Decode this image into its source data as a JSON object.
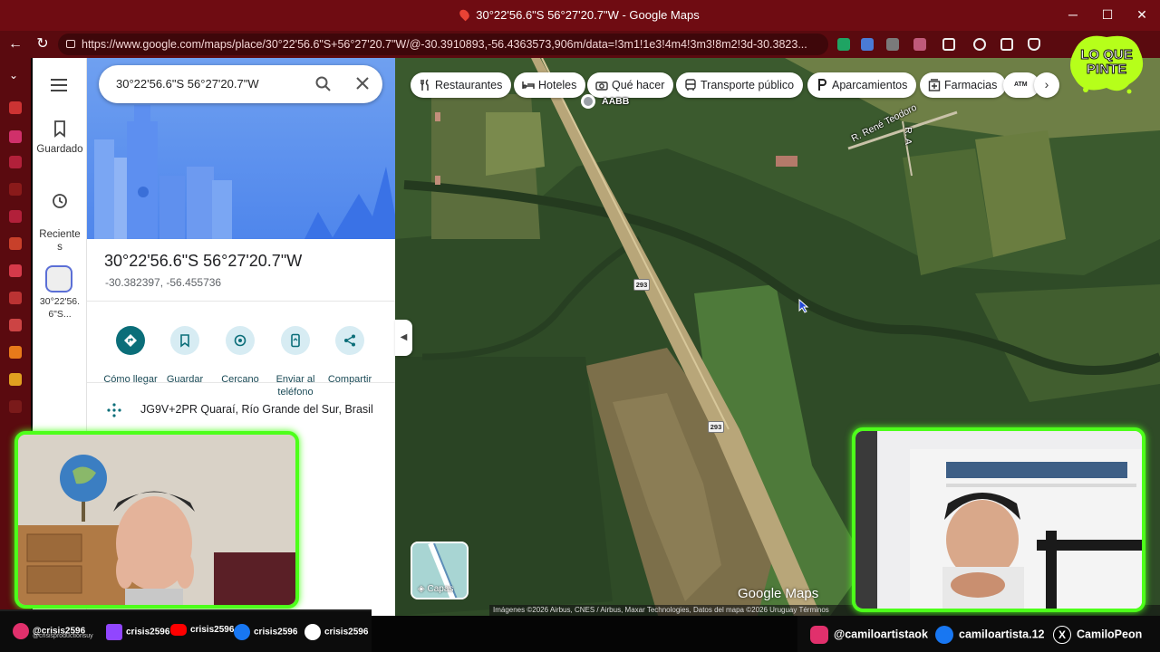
{
  "window": {
    "title": "30°22'56.6\"S 56°27'20.7\"W - Google Maps",
    "minimize": "─",
    "close": "✕"
  },
  "browser": {
    "url": "https://www.google.com/maps/place/30°22'56.6\"S+56°27'20.7\"W/@-30.3910893,-56.4363573,906m/data=!3m1!1e3!4m4!3m3!8m2!3d-30.3823..."
  },
  "sidebar_rail": {
    "saved_label": "Guardado",
    "recent_label": "Reciente\ns",
    "recent_item_label": "30°22'56.\n6\"S..."
  },
  "search": {
    "value": "30°22'56.6\"S 56°27'20.7\"W"
  },
  "place": {
    "title": "30°22'56.6\"S 56°27'20.7\"W",
    "coordinates": "-30.382397, -56.455736",
    "plus_code": "JG9V+2PR Quaraí, Río Grande del Sur, Brasil"
  },
  "actions": [
    {
      "label": "Cómo llegar",
      "icon": "directions-icon"
    },
    {
      "label": "Guardar",
      "icon": "bookmark-icon"
    },
    {
      "label": "Cercano",
      "icon": "nearby-icon"
    },
    {
      "label": "Enviar al\nteléfono",
      "icon": "phone-icon"
    },
    {
      "label": "Compartir",
      "icon": "share-icon"
    }
  ],
  "map": {
    "chips": [
      {
        "label": "Restaurantes",
        "icon": "fork-knife-icon"
      },
      {
        "label": "Hoteles",
        "icon": "bed-icon"
      },
      {
        "label": "Qué hacer",
        "icon": "camera-icon"
      },
      {
        "label": "Transporte público",
        "icon": "bus-icon"
      },
      {
        "label": "Aparcamientos",
        "icon": "parking-icon"
      },
      {
        "label": "Farmacias",
        "icon": "pharmacy-icon"
      },
      {
        "label": "ATM",
        "icon": "atm-icon"
      }
    ],
    "labels": {
      "poi": "AABB",
      "street": "R. René Teodoro",
      "street2": "R. A",
      "route1": "293",
      "route2": "293"
    },
    "layers_label": "Capas",
    "logo": "Google Maps",
    "attribution": "Imágenes ©2026 Airbus, CNES / Airbus, Maxar Technologies, Datos del mapa ©2026    Uruguay    Términos"
  },
  "overlay": {
    "badge_line1": "LO QUE",
    "badge_line2": "PINTE",
    "socials_left": [
      {
        "label": "@crisis2596",
        "sub": "@crisisproductionsuy",
        "icon": "instagram-icon",
        "color": "#e1306c"
      },
      {
        "label": "crisis2596",
        "icon": "twitch-icon",
        "color": "#9146ff"
      },
      {
        "label": "crisis2596",
        "icon": "youtube-icon",
        "color": "#ff0000"
      },
      {
        "label": "crisis2596",
        "icon": "facebook-icon",
        "color": "#1877f2"
      },
      {
        "label": "crisis2596",
        "icon": "threads-icon",
        "color": "#ffffff"
      }
    ],
    "socials_right": [
      {
        "label": "@camiloartistaok",
        "icon": "instagram-icon",
        "color": "#e1306c"
      },
      {
        "label": "camiloartista.12",
        "icon": "facebook-icon",
        "color": "#1877f2"
      },
      {
        "label": "CamiloPeon",
        "icon": "x-icon",
        "color": "#ffffff"
      }
    ]
  },
  "colors": {
    "accent_green": "#4dff1a",
    "browser_red": "#6f0c12",
    "maps_teal": "#0b6e79"
  }
}
